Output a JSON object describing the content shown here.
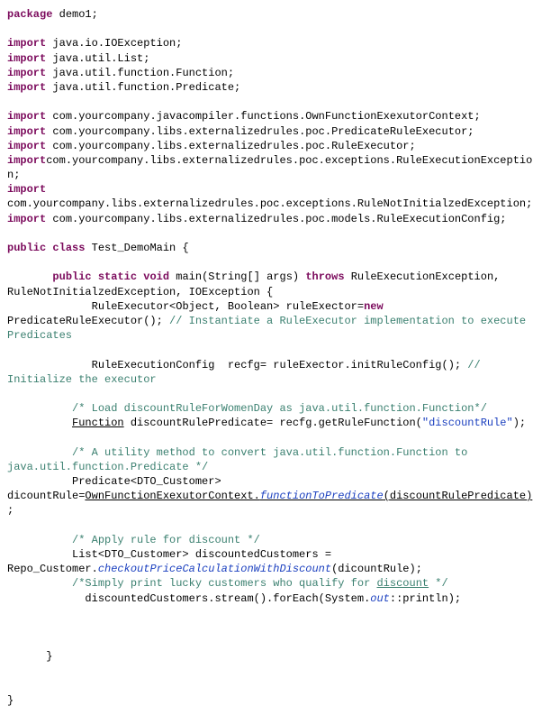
{
  "pkg_kw": "package",
  "pkg_name": " demo1;",
  "import_kw": "import",
  "imp1": " java.io.IOException;",
  "imp2": " java.util.List;",
  "imp3": " java.util.function.Function;",
  "imp4": " java.util.function.Predicate;",
  "imp5": " com.yourcompany.javacompiler.functions.OwnFunctionExexutorContext;",
  "imp6": " com.yourcompany.libs.externalizedrules.poc.PredicateRuleExecutor;",
  "imp7": " com.yourcompany.libs.externalizedrules.poc.RuleExecutor;",
  "imp8a": "com.yourcompany.libs.externalizedrules.poc.exceptions.RuleExecutionException;",
  "imp9": " com.yourcompany.libs.externalizedrules.poc.exceptions.RuleNotInitialzedException;",
  "imp10": " com.yourcompany.libs.externalizedrules.poc.models.RuleExecutionConfig;",
  "public_kw": "public",
  "class_kw": "class",
  "class_name": " Test_DemoMain {",
  "static_kw": "static",
  "void_kw": "void",
  "main_sig": " main(String[] args) ",
  "throws_kw": "throws",
  "throws_list": " RuleExecutionException, RuleNotInitialzedException, IOException {",
  "exec_decl": "             RuleExecutor<Object, Boolean> ruleExector=",
  "new_kw": "new",
  "exec_ctor": "PredicateRuleExecutor(); ",
  "cm_inst": "// Instantiate a RuleExecutor implementation to execute Predicates",
  "recfg_line": "             RuleExecutionConfig  recfg= ruleExector.initRuleConfig(); ",
  "cm_init": "// Initialize the executor",
  "cm_load": "          /* Load discountRuleForWomenDay as java.util.function.Function*/",
  "fn_u": "Function",
  "fn_rest": " discountRulePredicate= recfg.getRuleFunction(",
  "fn_str": "\"discountRule\"",
  "fn_end": ");",
  "cm_util": "          /* A utility method to convert java.util.function.Function to java.util.function.Predicate */",
  "pred_pre": "          Predicate<DTO_Customer> dicountRule=",
  "pred_class": "OwnFunctionExexutorContext.",
  "pred_method": "functionToPredicate",
  "pred_args_open": "(",
  "pred_arg": "discountRulePredicate)",
  "pred_semi": ";",
  "cm_apply": "          /* Apply rule for discount */",
  "list_line": "          List<DTO_Customer> discountedCustomers = Repo_Customer.",
  "repo_method": "checkoutPriceCalculationWithDiscount",
  "repo_args": "(dicountRule);",
  "cm_print_pre": "          /*Simply print lucky customers who qualify for ",
  "cm_print_u": "discount",
  "cm_print_post": " */",
  "stream_line": "            discountedCustomers.stream().forEach(System.",
  "out_ref": "out",
  "stream_end": "::println);",
  "close_method": "      }",
  "close_class": "}"
}
